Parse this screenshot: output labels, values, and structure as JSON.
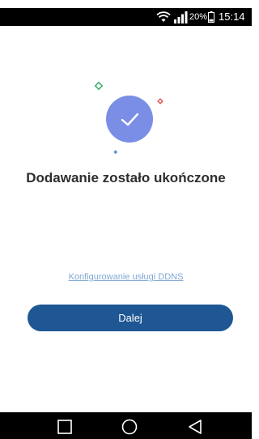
{
  "status_bar": {
    "battery_percent": "20%",
    "time": "15:14",
    "icons": [
      "wifi-icon",
      "signal-icon",
      "battery-icon"
    ]
  },
  "main": {
    "title": "Dodawanie zostało ukończone",
    "ddns_link": "Konfigurowanie usługi DDNS",
    "next_button": "Dalej",
    "success_icon": "check-circle-icon"
  },
  "nav_bar": {
    "icons": [
      "recents-icon",
      "home-icon",
      "back-icon"
    ]
  },
  "colors": {
    "accent": "#1e5793",
    "link": "#7fa8d6",
    "check_circle": "#7a8ee6",
    "title": "#2e2e2e",
    "sparkle_green": "#3cb371",
    "sparkle_red": "#e05b5b",
    "sparkle_blue": "#5b8de0"
  }
}
